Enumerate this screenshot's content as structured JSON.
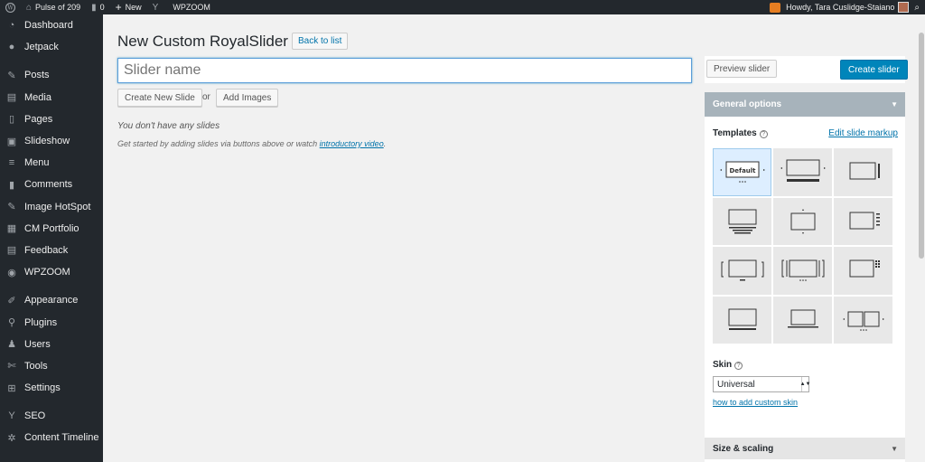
{
  "adminbar": {
    "site_name": "Pulse of 209",
    "comments_count": "0",
    "new_label": "New",
    "plugin_label": "WPZOOM",
    "howdy": "Howdy, Tara Cuslidge-Staiano"
  },
  "sidebar": {
    "items": [
      {
        "label": "Dashboard",
        "icon": "dashboard-icon"
      },
      {
        "label": "Jetpack",
        "icon": "jetpack-icon"
      },
      {
        "label": "Posts",
        "icon": "pin-icon"
      },
      {
        "label": "Media",
        "icon": "media-icon"
      },
      {
        "label": "Pages",
        "icon": "pages-icon"
      },
      {
        "label": "Slideshow",
        "icon": "slideshow-icon"
      },
      {
        "label": "Menu",
        "icon": "menu-icon"
      },
      {
        "label": "Comments",
        "icon": "comments-icon"
      },
      {
        "label": "Image HotSpot",
        "icon": "pin-icon"
      },
      {
        "label": "CM Portfolio",
        "icon": "portfolio-icon"
      },
      {
        "label": "Feedback",
        "icon": "feedback-icon"
      },
      {
        "label": "WPZOOM",
        "icon": "wpzoom-icon"
      },
      {
        "label": "Appearance",
        "icon": "brush-icon"
      },
      {
        "label": "Plugins",
        "icon": "plugin-icon"
      },
      {
        "label": "Users",
        "icon": "users-icon"
      },
      {
        "label": "Tools",
        "icon": "wrench-icon"
      },
      {
        "label": "Settings",
        "icon": "settings-icon"
      },
      {
        "label": "SEO",
        "icon": "seo-icon"
      },
      {
        "label": "Content Timeline",
        "icon": "gear-icon"
      }
    ]
  },
  "main": {
    "title": "New Custom RoyalSlider",
    "back_label": "Back to list",
    "slider_name_placeholder": "Slider name",
    "create_slide_label": "Create New Slide",
    "or_label": "or",
    "add_images_label": "Add Images",
    "empty_title": "You don't have any slides",
    "empty_desc": "Get started by adding slides via buttons above or watch",
    "empty_link": "introductory video",
    "empty_end": "."
  },
  "right": {
    "preview_label": "Preview slider",
    "create_label": "Create slider",
    "general_options": "General options",
    "templates_label": "Templates",
    "edit_markup": "Edit slide markup",
    "default_template": "Default",
    "skin_label": "Skin",
    "skin_value": "Universal",
    "skin_link": "how to add custom skin",
    "size_scaling": "Size & scaling"
  },
  "colors": {
    "admin_dark": "#23282d",
    "link": "#0073aa",
    "primary": "#0085ba",
    "panel_head": "#a7b3bb"
  }
}
